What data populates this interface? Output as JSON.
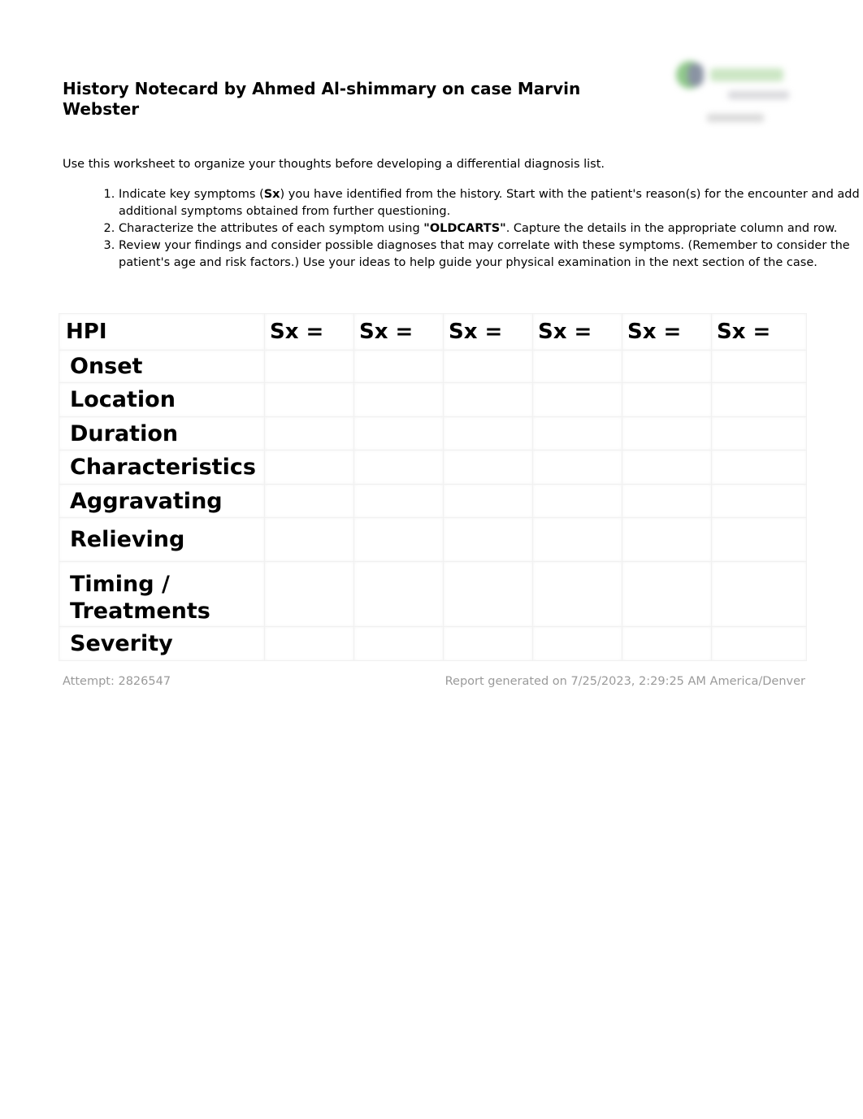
{
  "header": {
    "title": "History Notecard by Ahmed Al-shimmary on case Marvin Webster",
    "logo_icon": "organization-logo"
  },
  "intro": "Use this worksheet to organize your thoughts before developing a differential diagnosis list.",
  "steps": [
    {
      "before": "Indicate key symptoms (",
      "bold": "Sx",
      "after": ") you have identified from the history. Start with the patient's reason(s) for the encounter and add additional symptoms obtained from further questioning."
    },
    {
      "before": "Characterize the attributes of each symptom using ",
      "bold": "\"OLDCARTS\"",
      "after": ". Capture the details in the appropriate column and row."
    },
    {
      "before": "Review your findings and consider possible diagnoses that may correlate with these symptoms. (Remember to consider the patient's age and risk factors.) Use your ideas to help guide your physical examination in the next section of the case.",
      "bold": "",
      "after": ""
    }
  ],
  "table": {
    "header_label": "HPI",
    "symptom_columns": [
      "Sx =",
      "Sx =",
      "Sx =",
      "Sx =",
      "Sx =",
      "Sx ="
    ],
    "rows": [
      {
        "label": "Onset",
        "values": [
          "",
          "",
          "",
          "",
          "",
          ""
        ]
      },
      {
        "label": "Location",
        "values": [
          "",
          "",
          "",
          "",
          "",
          ""
        ]
      },
      {
        "label": "Duration",
        "values": [
          "",
          "",
          "",
          "",
          "",
          ""
        ]
      },
      {
        "label": "Characteristics",
        "values": [
          "",
          "",
          "",
          "",
          "",
          ""
        ]
      },
      {
        "label": "Aggravating",
        "values": [
          "",
          "",
          "",
          "",
          "",
          ""
        ]
      },
      {
        "label": "Relieving",
        "values": [
          "",
          "",
          "",
          "",
          "",
          ""
        ]
      },
      {
        "label": "Timing / Treatments",
        "values": [
          "",
          "",
          "",
          "",
          "",
          ""
        ]
      },
      {
        "label": "Severity",
        "values": [
          "",
          "",
          "",
          "",
          "",
          ""
        ]
      }
    ]
  },
  "footer": {
    "attempt": "Attempt: 2826547",
    "generated": "Report generated on 7/25/2023, 2:29:25 AM America/Denver"
  }
}
